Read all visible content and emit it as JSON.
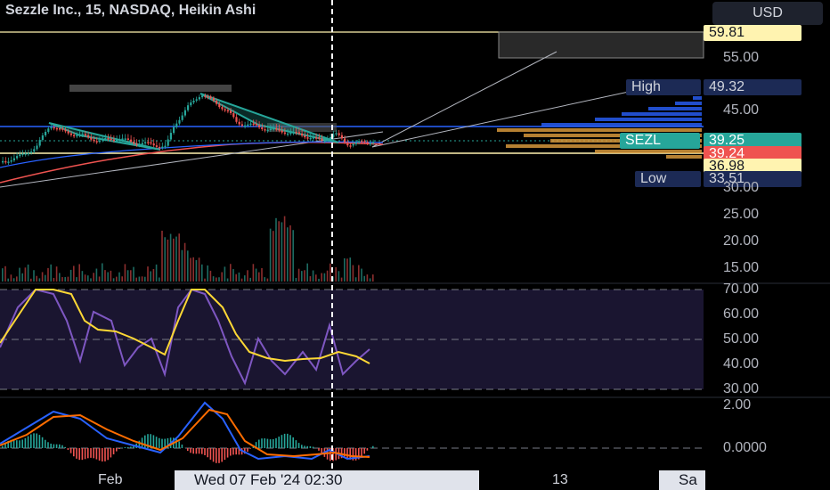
{
  "header": {
    "title": "Sezzle Inc., 15, NASDAQ, Heikin Ashi",
    "currency_button": "USD"
  },
  "price_axis": {
    "ticks": [
      "55.00",
      "45.00",
      "30.00",
      "25.00",
      "20.00",
      "15.00"
    ],
    "labels": {
      "top_line": "59.81",
      "high_text": "High",
      "high_value": "49.32",
      "symbol": "SEZL",
      "symbol_price": "39.25",
      "red_price": "39.24",
      "yellow_price": "36.98",
      "low_text": "Low",
      "low_value": "33.51"
    }
  },
  "rsi_axis": {
    "ticks": [
      "70.00",
      "60.00",
      "50.00",
      "40.00",
      "30.00"
    ]
  },
  "macd_axis": {
    "ticks": [
      "2.00",
      "0.0000"
    ]
  },
  "time_axis": {
    "feb_label": "Feb",
    "cursor_label": "Wed 07 Feb '24   02:30",
    "day_13": "13",
    "right_label": "Sa"
  },
  "colors": {
    "background": "#000000",
    "up": "#26a69a",
    "down": "#ef5350",
    "hline_yellow": "#fff3b0",
    "hline_blue": "#2962ff",
    "rsi": "#7e57c2",
    "rsi_ma": "#fdd835",
    "macd": "#2962ff",
    "signal": "#ff6d00",
    "volume_profile": "#e2a03f"
  }
}
